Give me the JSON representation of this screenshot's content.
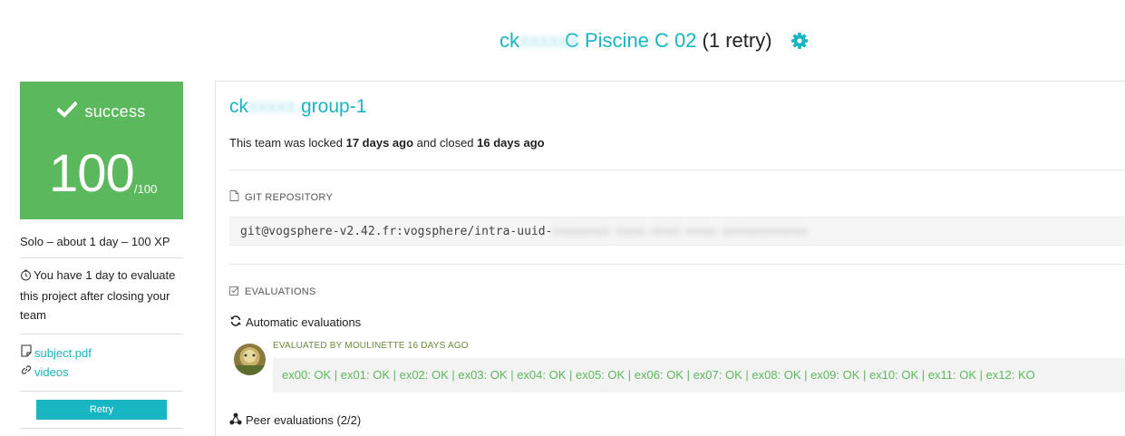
{
  "header": {
    "title_prefix": "ck",
    "title_blurred": "xxxxxx",
    "title_project": " C Piscine C 02",
    "retry_label": "(1 retry)",
    "settings_icon": "gear-icon"
  },
  "sidebar": {
    "status": "success",
    "score": "100",
    "score_max": "/100",
    "meta": "Solo – about 1 day – 100 XP",
    "evaluation_notice": "You have 1 day to evaluate this project after closing your team",
    "links": [
      {
        "label": "subject.pdf",
        "icon": "document-icon"
      },
      {
        "label": "videos",
        "icon": "link-icon"
      }
    ],
    "retry_button": "Retry"
  },
  "main": {
    "team_prefix": "ck",
    "team_blurred": "xxxxx",
    "team_suffix": "group-1",
    "status_text_1": "This team was locked ",
    "status_bold_1": "17 days ago",
    "status_text_2": " and closed ",
    "status_bold_2": "16 days ago",
    "git_section": "GIT REPOSITORY",
    "git_url": "git@vogsphere-v2.42.fr:vogsphere/intra-uuid-",
    "git_url_blurred": "xxxxxxxx-xxxx-xxxx-xxxx-xxxxxxxxxxxx",
    "evaluations_section": "EVALUATIONS",
    "automatic_label": "Automatic evaluations",
    "evaluated_by": "EVALUATED BY MOULINETTE 16 DAYS AGO",
    "results": "ex00: OK | ex01: OK | ex02: OK | ex03: OK | ex04: OK | ex05: OK | ex06: OK | ex07: OK | ex08: OK | ex09: OK | ex10: OK | ex11: OK | ex12: KO",
    "peer_label": "Peer evaluations (2/2)"
  },
  "colors": {
    "accent": "#18b5c2",
    "success": "#5cb85c"
  }
}
